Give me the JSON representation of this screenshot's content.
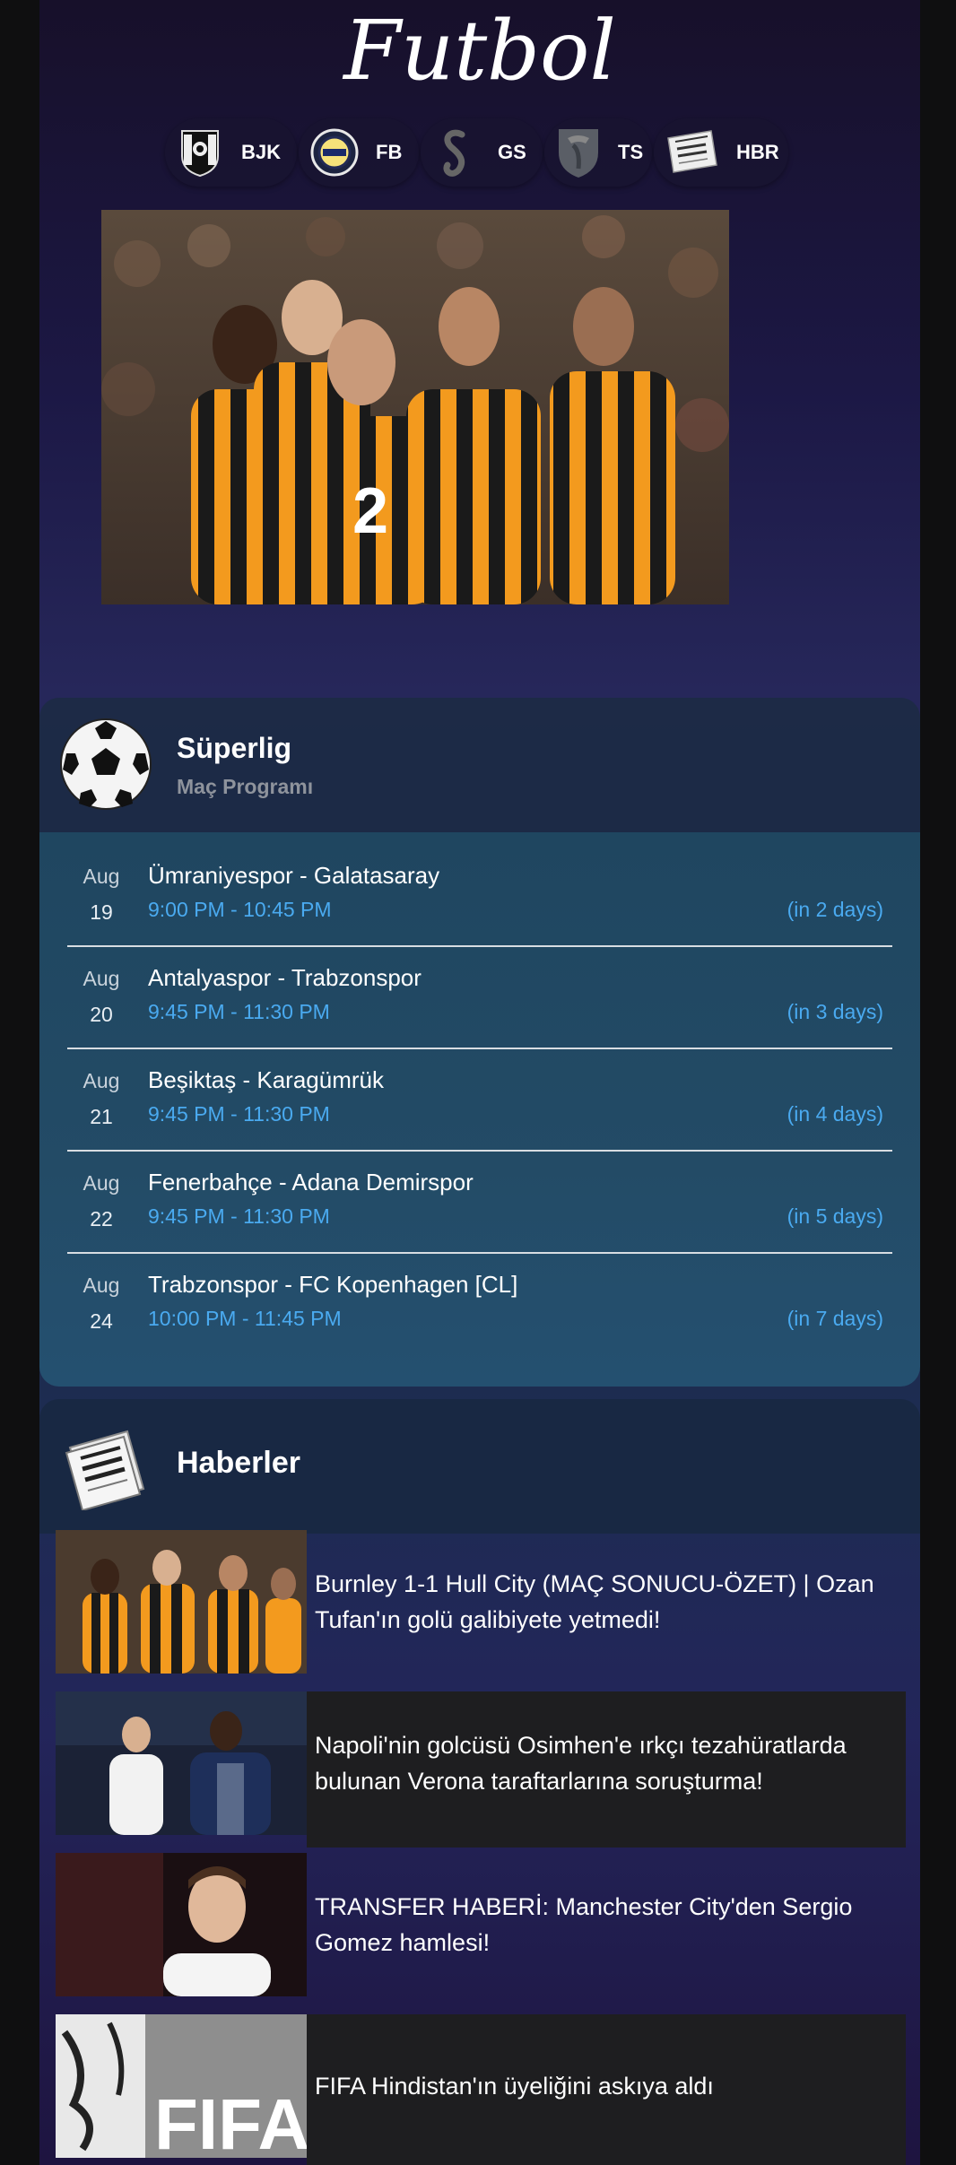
{
  "app": {
    "title": "Futbol"
  },
  "teams": [
    {
      "abbr": "BJK",
      "icon": "besiktas-crest-icon"
    },
    {
      "abbr": "FB",
      "icon": "fenerbahce-crest-icon"
    },
    {
      "abbr": "GS",
      "icon": "galatasaray-crest-icon"
    },
    {
      "abbr": "TS",
      "icon": "trabzonspor-crest-icon"
    },
    {
      "abbr": "HBR",
      "icon": "newspaper-icon"
    }
  ],
  "schedule": {
    "title": "Süperlig",
    "subtitle": "Maç Programı",
    "matches": [
      {
        "month": "Aug",
        "day": "19",
        "teams": "Ümraniyespor - Galatasaray",
        "time": "9:00 PM - 10:45 PM",
        "relative": "(in 2 days)"
      },
      {
        "month": "Aug",
        "day": "20",
        "teams": "Antalyaspor - Trabzonspor",
        "time": "9:45 PM - 11:30 PM",
        "relative": "(in 3 days)"
      },
      {
        "month": "Aug",
        "day": "21",
        "teams": "Beşiktaş - Karagümrük",
        "time": "9:45 PM - 11:30 PM",
        "relative": "(in 4 days)"
      },
      {
        "month": "Aug",
        "day": "22",
        "teams": "Fenerbahçe - Adana Demirspor",
        "time": "9:45 PM - 11:30 PM",
        "relative": "(in 5 days)"
      },
      {
        "month": "Aug",
        "day": "24",
        "teams": "Trabzonspor - FC Kopenhagen [CL]",
        "time": "10:00 PM - 11:45 PM",
        "relative": "(in 7 days)"
      }
    ]
  },
  "news": {
    "title": "Haberler",
    "items": [
      {
        "text": "Burnley 1-1 Hull City (MAÇ SONUCU-ÖZET) | Ozan Tufan'ın golü galibiyete yetmedi!"
      },
      {
        "text": "Napoli'nin golcüsü Osimhen'e ırkçı tezahüratlarda bulunan Verona taraftarlarına soruşturma!"
      },
      {
        "text": "TRANSFER HABERİ: Manchester City'den Sergio Gomez hamlesi!"
      },
      {
        "text": "FIFA Hindistan'ın üyeliğini askıya aldı"
      }
    ]
  },
  "colors": {
    "accent_time": "#4aaaf0",
    "hull_orange": "#f39a1e",
    "card_dark": "#1e1e20"
  }
}
